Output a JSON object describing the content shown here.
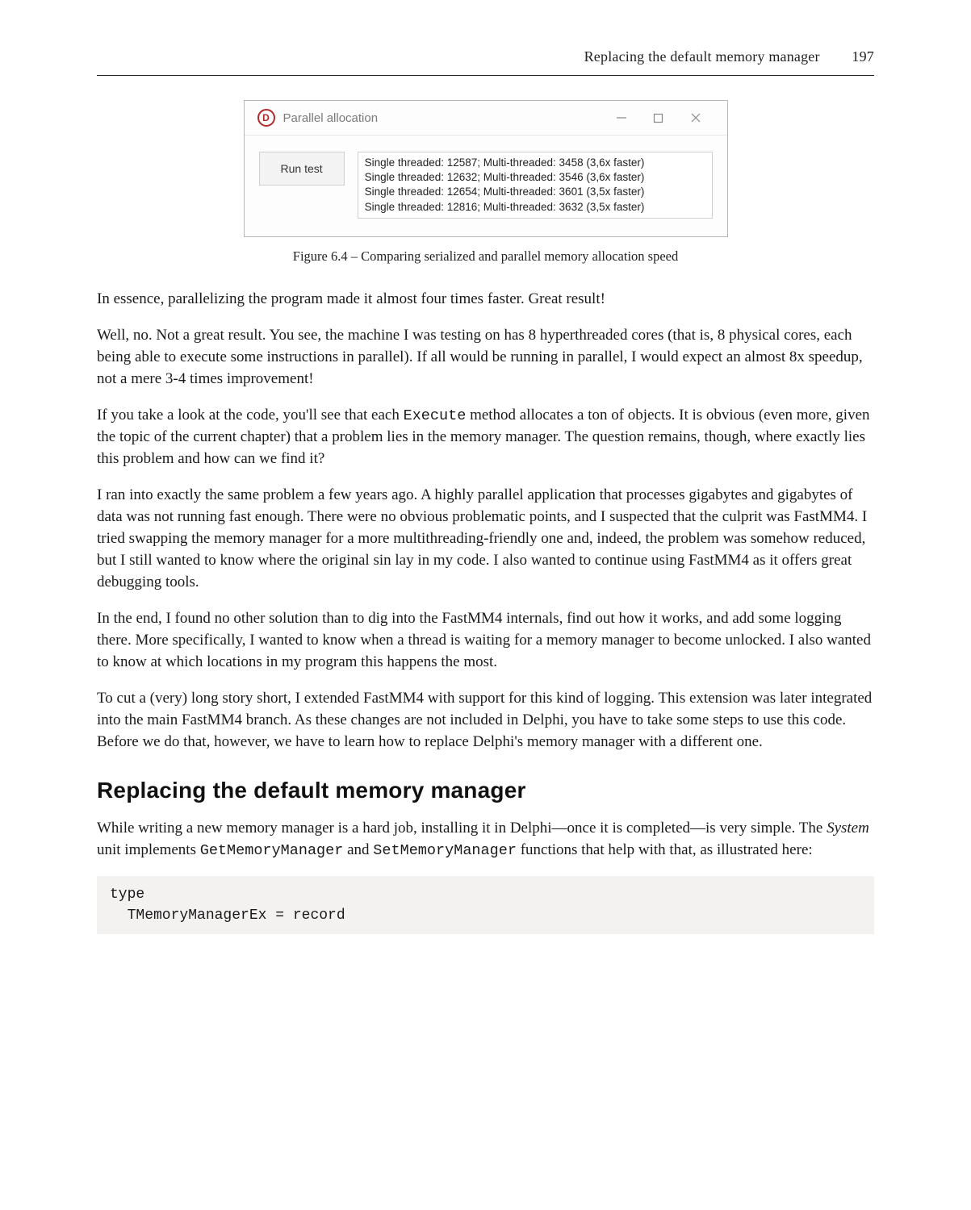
{
  "header": {
    "running_title": "Replacing the default memory manager",
    "page_number": "197"
  },
  "window": {
    "title": "Parallel allocation",
    "icon_letter": "D",
    "button_label": "Run test",
    "results": [
      "Single threaded: 12587; Multi-threaded: 3458 (3,6x faster)",
      "Single threaded: 12632; Multi-threaded: 3546 (3,6x faster)",
      "Single threaded: 12654; Multi-threaded: 3601 (3,5x faster)",
      "Single threaded: 12816; Multi-threaded: 3632 (3,5x faster)"
    ]
  },
  "caption": "Figure 6.4 – Comparing serialized and parallel memory allocation speed",
  "paragraphs": {
    "p1": "In essence, parallelizing the program made it almost four times faster. Great result!",
    "p2": "Well, no. Not a great result. You see, the machine I was testing on has 8 hyperthreaded cores (that is, 8 physical cores, each being able to execute some instructions in parallel). If all would be running in parallel, I would expect an almost 8x speedup, not a mere 3-4 times improvement!",
    "p3_a": "If you take a look at the code, you'll see that each ",
    "p3_code": "Execute",
    "p3_b": " method allocates a ton of objects. It is obvious (even more, given the topic of the current chapter) that a problem lies in the memory manager. The question remains, though, where exactly lies this problem and how can we find it?",
    "p4": "I ran into exactly the same problem a few years ago. A highly parallel application that processes gigabytes and gigabytes of data was not running fast enough. There were no obvious problematic points, and I suspected that the culprit was FastMM4. I tried swapping the memory manager for a more multithreading-friendly one and, indeed, the problem was somehow reduced, but I still wanted to know where the original sin lay in my code. I also wanted to continue using FastMM4 as it offers great debugging tools.",
    "p5": "In the end, I found no other solution than to dig into the FastMM4 internals, find out how it works, and add some logging there. More specifically, I wanted to know when a thread is waiting for a memory manager to become unlocked. I also wanted to know at which locations in my program this happens the most.",
    "p6": "To cut a (very) long story short, I extended FastMM4 with support for this kind of logging. This extension was later integrated into the main FastMM4 branch. As these changes are not included in Delphi, you have to take some steps to use this code. Before we do that, however, we have to learn how to replace Delphi's memory manager with a different one."
  },
  "section_heading": "Replacing the default memory manager",
  "paragraphs2": {
    "p7_a": "While writing a new memory manager is a hard job, installing it in Delphi—once it is completed—is very simple. The ",
    "p7_em": "System",
    "p7_b": " unit implements ",
    "p7_code1": "GetMemoryManager",
    "p7_c": " and ",
    "p7_code2": "SetMemoryManager",
    "p7_d": " functions that help with that, as illustrated here:"
  },
  "code": "type\n  TMemoryManagerEx = record"
}
